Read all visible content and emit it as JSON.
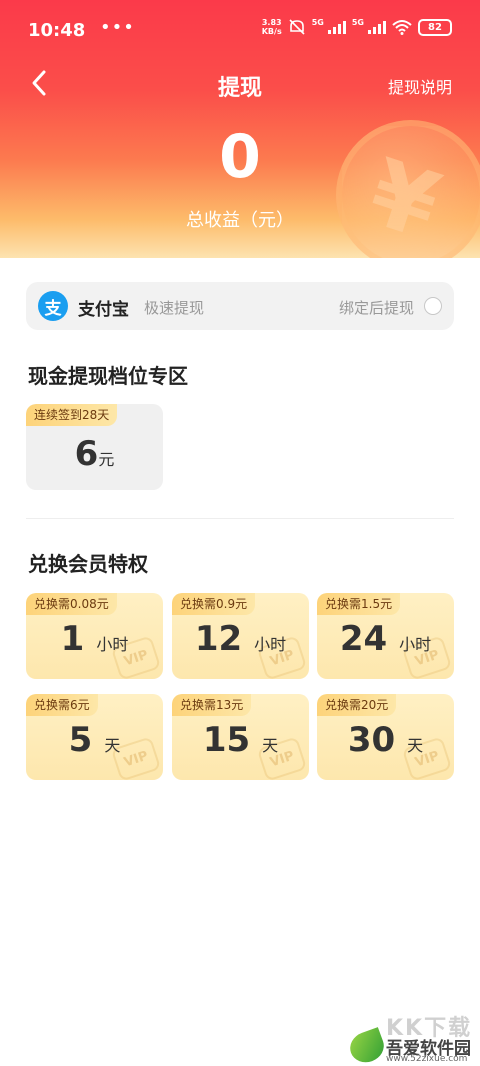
{
  "status_bar": {
    "time": "10:48",
    "dots": "•••",
    "speed_value": "3.83",
    "speed_unit": "KB/s",
    "signal1_label": "5G",
    "signal2_label": "5G",
    "battery": "82"
  },
  "nav": {
    "title": "提现",
    "help": "提现说明"
  },
  "balance": {
    "amount": "0",
    "label": "总收益（元）"
  },
  "alipay": {
    "logo_char": "支",
    "name": "支付宝",
    "subtitle": "极速提现",
    "bind_text": "绑定后提现"
  },
  "cash_section": {
    "title": "现金提现档位专区",
    "items": [
      {
        "tag": "连续签到28天",
        "value": "6",
        "unit": "元"
      }
    ]
  },
  "vip_section": {
    "title": "兑换会员特权",
    "watermark": "VIP",
    "items": [
      {
        "tag": "兑换需0.08元",
        "value": "1",
        "unit": "小时"
      },
      {
        "tag": "兑换需0.9元",
        "value": "12",
        "unit": "小时"
      },
      {
        "tag": "兑换需1.5元",
        "value": "24",
        "unit": "小时"
      },
      {
        "tag": "兑换需6元",
        "value": "5",
        "unit": "天"
      },
      {
        "tag": "兑换需13元",
        "value": "15",
        "unit": "天"
      },
      {
        "tag": "兑换需20元",
        "value": "30",
        "unit": "天"
      }
    ]
  },
  "watermark": {
    "top": "KK下载",
    "name": "吾爱软件园",
    "url": "www.52zixue.com"
  },
  "colors": {
    "header_top": "#fb3a4a",
    "header_bottom": "#fde3b0",
    "alipay_blue": "#1a9ef0",
    "vip_card": "#fde7ad",
    "tag": "#fdd37a"
  }
}
